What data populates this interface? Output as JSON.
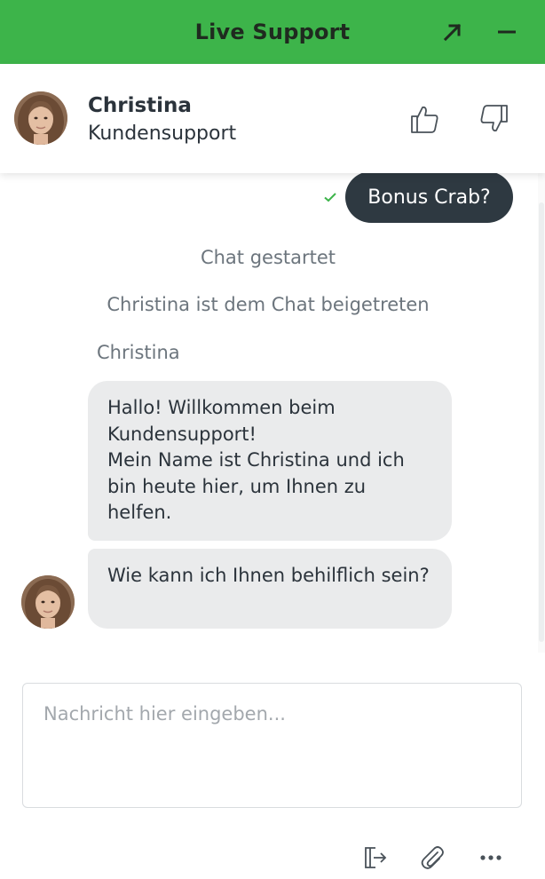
{
  "header": {
    "title": "Live Support",
    "expand_icon": "arrow-up-right-icon",
    "minimize_icon": "minus-icon",
    "color": "#3db44a"
  },
  "agent": {
    "name": "Christina",
    "role": "Kundensupport",
    "avatar": "agent-photo",
    "rating_up_icon": "thumbs-up-icon",
    "rating_down_icon": "thumbs-down-icon"
  },
  "messages": {
    "user": {
      "text": "Bonus Crab?",
      "status_icon": "checkmark-icon",
      "bubble_color": "#2e3941"
    },
    "system": [
      "Chat gestartet",
      "Christina ist dem Chat beigetreten"
    ],
    "agent_sender_label": "Christina",
    "agent_messages": [
      "Hallo! Willkommen beim Kundensupport!\nMein Name ist Christina und ich bin heute hier, um Ihnen zu helfen.",
      "Wie kann ich Ihnen behilflich sein?"
    ],
    "agent_bubble_color": "#eaebec"
  },
  "composer": {
    "placeholder": "Nachricht hier eingeben...",
    "value": ""
  },
  "footer": {
    "icons": [
      "exit-chat-icon",
      "paperclip-icon",
      "more-dots-icon"
    ]
  }
}
